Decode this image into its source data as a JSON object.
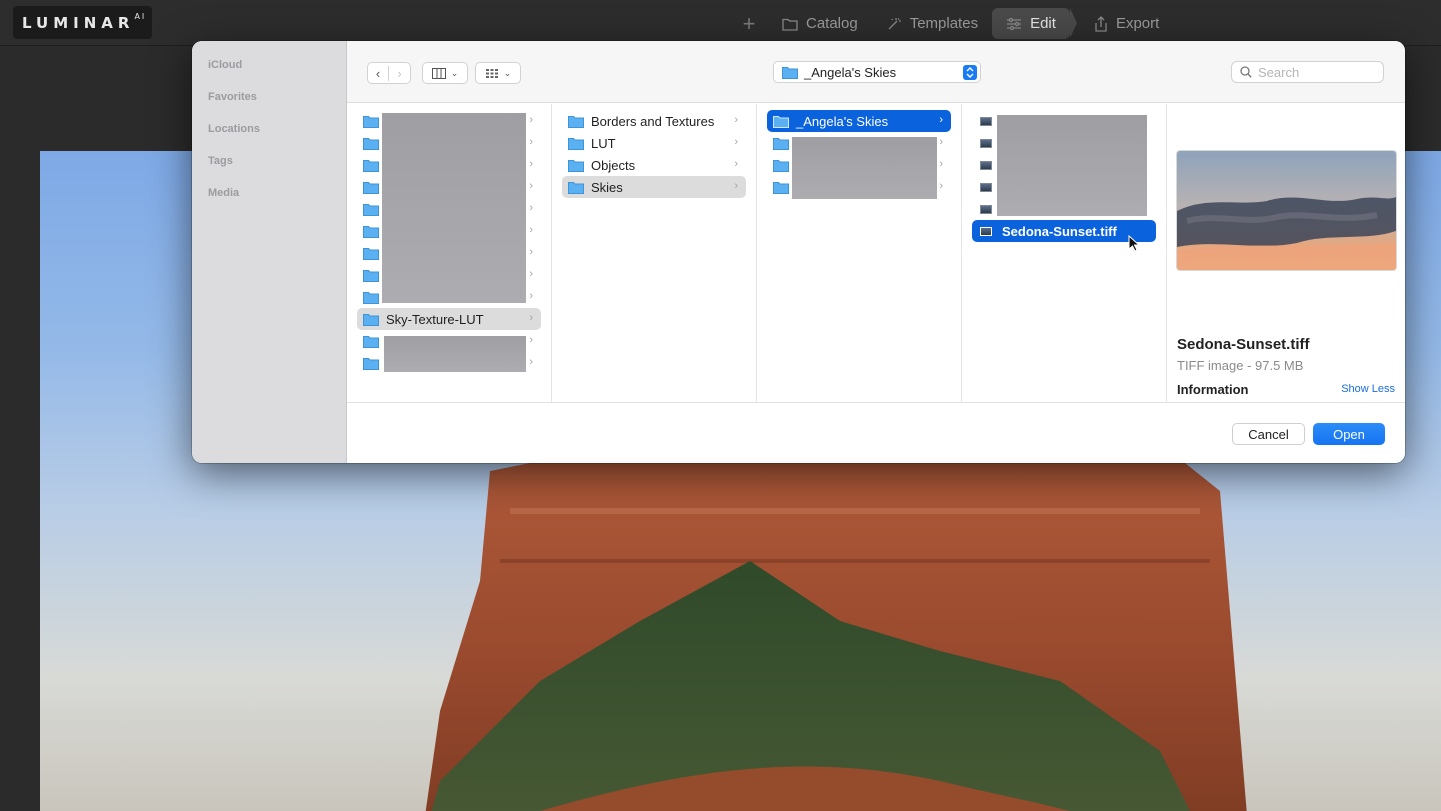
{
  "app": {
    "logo_text": "LUMINAR",
    "logo_sup": "AI",
    "nav": [
      {
        "label": "Catalog"
      },
      {
        "label": "Templates"
      },
      {
        "label": "Edit"
      },
      {
        "label": "Export"
      }
    ]
  },
  "dialog": {
    "sidebar": [
      "iCloud",
      "Favorites",
      "Locations",
      "Tags",
      "Media"
    ],
    "path_popup": "_Angela's Skies",
    "search_placeholder": "Search",
    "column1": {
      "selected": "Sky-Texture-LUT"
    },
    "column2": {
      "items": [
        "Borders and Textures",
        "LUT",
        "Objects",
        "Skies"
      ],
      "selected": "Skies"
    },
    "column3": {
      "selected": "_Angela's Skies"
    },
    "column4": {
      "selected": "Sedona-Sunset.tiff"
    },
    "preview": {
      "filename": "Sedona-Sunset.tiff",
      "meta": "TIFF image - 97.5 MB",
      "info_heading": "Information",
      "show_less": "Show Less"
    },
    "buttons": {
      "cancel": "Cancel",
      "open": "Open"
    }
  },
  "colors": {
    "accent": "#0a63dd",
    "open_button": "#1a7cf3",
    "folder": "#5ab0f0"
  }
}
